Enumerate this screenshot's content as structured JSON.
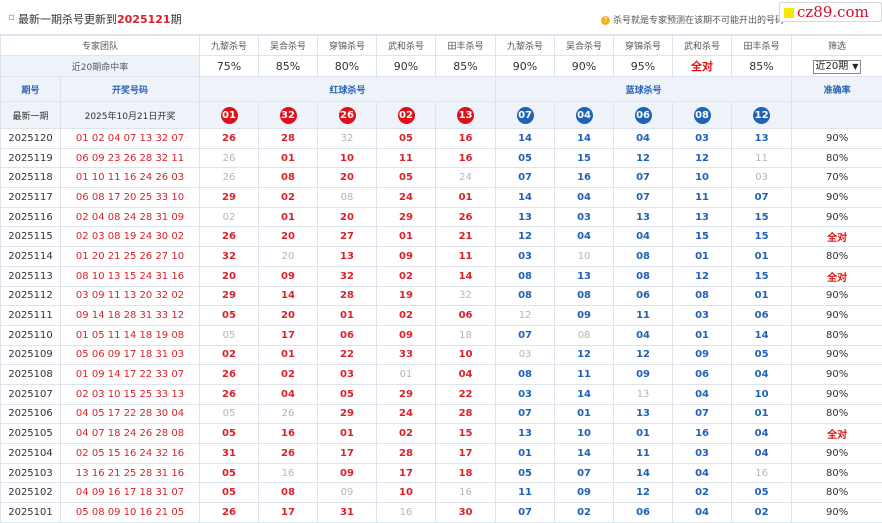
{
  "header": {
    "title_prefix": "最新一期杀号更新到",
    "title_issue": "2025121",
    "title_suffix": "期",
    "hint": "杀号就是专家预测在该期不可能开出的号码"
  },
  "logo": {
    "text": "cz89.com"
  },
  "experts": {
    "label": "专家团队",
    "names": [
      "九黎杀号",
      "吴合杀号",
      "穿锦杀号",
      "武和杀号",
      "田丰杀号",
      "九黎杀号",
      "吴合杀号",
      "穿锦杀号",
      "武和杀号",
      "田丰杀号"
    ],
    "filter_label": "筛选",
    "rate_label": "近20期命中率",
    "rates": [
      "75%",
      "85%",
      "80%",
      "90%",
      "85%",
      "90%",
      "90%",
      "95%",
      "全对",
      "85%"
    ],
    "select_value": "近20期"
  },
  "table": {
    "col_issue": "期号",
    "col_draw": "开奖号码",
    "col_red": "红球杀号",
    "col_blue": "蓝球杀号",
    "col_acc": "准确率",
    "latest_label": "最新一期",
    "latest_date": "2025年10月21日开奖",
    "latest_red": [
      "01",
      "32",
      "26",
      "02",
      "13"
    ],
    "latest_blue": [
      "07",
      "04",
      "06",
      "08",
      "12"
    ]
  },
  "rows": [
    {
      "issue": "2025120",
      "draw": "01 02 04 07 13 32 07",
      "red": [
        [
          "26",
          1
        ],
        [
          "28",
          1
        ],
        [
          "32",
          0
        ],
        [
          "05",
          1
        ],
        [
          "16",
          1
        ]
      ],
      "blue": [
        [
          "14",
          1
        ],
        [
          "14",
          1
        ],
        [
          "04",
          1
        ],
        [
          "03",
          1
        ],
        [
          "13",
          1
        ]
      ],
      "acc": "90%"
    },
    {
      "issue": "2025119",
      "draw": "06 09 23 26 28 32 11",
      "red": [
        [
          "26",
          0
        ],
        [
          "01",
          1
        ],
        [
          "10",
          1
        ],
        [
          "11",
          1
        ],
        [
          "16",
          1
        ]
      ],
      "blue": [
        [
          "05",
          1
        ],
        [
          "15",
          1
        ],
        [
          "12",
          1
        ],
        [
          "12",
          1
        ],
        [
          "11",
          0
        ]
      ],
      "acc": "80%"
    },
    {
      "issue": "2025118",
      "draw": "01 10 11 16 24 26 03",
      "red": [
        [
          "26",
          0
        ],
        [
          "08",
          1
        ],
        [
          "20",
          1
        ],
        [
          "05",
          1
        ],
        [
          "24",
          0
        ]
      ],
      "blue": [
        [
          "07",
          1
        ],
        [
          "16",
          1
        ],
        [
          "07",
          1
        ],
        [
          "10",
          1
        ],
        [
          "03",
          0
        ]
      ],
      "acc": "70%"
    },
    {
      "issue": "2025117",
      "draw": "06 08 17 20 25 33 10",
      "red": [
        [
          "29",
          1
        ],
        [
          "02",
          1
        ],
        [
          "08",
          0
        ],
        [
          "24",
          1
        ],
        [
          "01",
          1
        ]
      ],
      "blue": [
        [
          "14",
          1
        ],
        [
          "04",
          1
        ],
        [
          "07",
          1
        ],
        [
          "11",
          1
        ],
        [
          "07",
          1
        ]
      ],
      "acc": "90%"
    },
    {
      "issue": "2025116",
      "draw": "02 04 08 24 28 31 09",
      "red": [
        [
          "02",
          0
        ],
        [
          "01",
          1
        ],
        [
          "20",
          1
        ],
        [
          "29",
          1
        ],
        [
          "26",
          1
        ]
      ],
      "blue": [
        [
          "13",
          1
        ],
        [
          "03",
          1
        ],
        [
          "13",
          1
        ],
        [
          "13",
          1
        ],
        [
          "15",
          1
        ]
      ],
      "acc": "90%"
    },
    {
      "issue": "2025115",
      "draw": "02 03 08 19 24 30 02",
      "red": [
        [
          "26",
          1
        ],
        [
          "20",
          1
        ],
        [
          "27",
          1
        ],
        [
          "01",
          1
        ],
        [
          "21",
          1
        ]
      ],
      "blue": [
        [
          "12",
          1
        ],
        [
          "04",
          1
        ],
        [
          "04",
          1
        ],
        [
          "15",
          1
        ],
        [
          "15",
          1
        ]
      ],
      "acc": "全对"
    },
    {
      "issue": "2025114",
      "draw": "01 20 21 25 26 27 10",
      "red": [
        [
          "32",
          1
        ],
        [
          "20",
          0
        ],
        [
          "13",
          1
        ],
        [
          "09",
          1
        ],
        [
          "11",
          1
        ]
      ],
      "blue": [
        [
          "03",
          1
        ],
        [
          "10",
          0
        ],
        [
          "08",
          1
        ],
        [
          "01",
          1
        ],
        [
          "01",
          1
        ]
      ],
      "acc": "80%"
    },
    {
      "issue": "2025113",
      "draw": "08 10 13 15 24 31 16",
      "red": [
        [
          "20",
          1
        ],
        [
          "09",
          1
        ],
        [
          "32",
          1
        ],
        [
          "02",
          1
        ],
        [
          "14",
          1
        ]
      ],
      "blue": [
        [
          "08",
          1
        ],
        [
          "13",
          1
        ],
        [
          "08",
          1
        ],
        [
          "12",
          1
        ],
        [
          "15",
          1
        ]
      ],
      "acc": "全对"
    },
    {
      "issue": "2025112",
      "draw": "03 09 11 13 20 32 02",
      "red": [
        [
          "29",
          1
        ],
        [
          "14",
          1
        ],
        [
          "28",
          1
        ],
        [
          "19",
          1
        ],
        [
          "32",
          0
        ]
      ],
      "blue": [
        [
          "08",
          1
        ],
        [
          "08",
          1
        ],
        [
          "06",
          1
        ],
        [
          "08",
          1
        ],
        [
          "01",
          1
        ]
      ],
      "acc": "90%"
    },
    {
      "issue": "2025111",
      "draw": "09 14 18 28 31 33 12",
      "red": [
        [
          "05",
          1
        ],
        [
          "20",
          1
        ],
        [
          "01",
          1
        ],
        [
          "02",
          1
        ],
        [
          "06",
          1
        ]
      ],
      "blue": [
        [
          "12",
          0
        ],
        [
          "09",
          1
        ],
        [
          "11",
          1
        ],
        [
          "03",
          1
        ],
        [
          "06",
          1
        ]
      ],
      "acc": "90%"
    },
    {
      "issue": "2025110",
      "draw": "01 05 11 14 18 19 08",
      "red": [
        [
          "05",
          0
        ],
        [
          "17",
          1
        ],
        [
          "06",
          1
        ],
        [
          "09",
          1
        ],
        [
          "18",
          0
        ]
      ],
      "blue": [
        [
          "07",
          1
        ],
        [
          "08",
          0
        ],
        [
          "04",
          1
        ],
        [
          "01",
          1
        ],
        [
          "14",
          1
        ]
      ],
      "acc": "80%"
    },
    {
      "issue": "2025109",
      "draw": "05 06 09 17 18 31 03",
      "red": [
        [
          "02",
          1
        ],
        [
          "01",
          1
        ],
        [
          "22",
          1
        ],
        [
          "33",
          1
        ],
        [
          "10",
          1
        ]
      ],
      "blue": [
        [
          "03",
          0
        ],
        [
          "12",
          1
        ],
        [
          "12",
          1
        ],
        [
          "09",
          1
        ],
        [
          "05",
          1
        ]
      ],
      "acc": "90%"
    },
    {
      "issue": "2025108",
      "draw": "01 09 14 17 22 33 07",
      "red": [
        [
          "26",
          1
        ],
        [
          "02",
          1
        ],
        [
          "03",
          1
        ],
        [
          "01",
          0
        ],
        [
          "04",
          1
        ]
      ],
      "blue": [
        [
          "08",
          1
        ],
        [
          "11",
          1
        ],
        [
          "09",
          1
        ],
        [
          "06",
          1
        ],
        [
          "04",
          1
        ]
      ],
      "acc": "90%"
    },
    {
      "issue": "2025107",
      "draw": "02 03 10 15 25 33 13",
      "red": [
        [
          "26",
          1
        ],
        [
          "04",
          1
        ],
        [
          "05",
          1
        ],
        [
          "29",
          1
        ],
        [
          "22",
          1
        ]
      ],
      "blue": [
        [
          "03",
          1
        ],
        [
          "14",
          1
        ],
        [
          "13",
          0
        ],
        [
          "04",
          1
        ],
        [
          "10",
          1
        ]
      ],
      "acc": "90%"
    },
    {
      "issue": "2025106",
      "draw": "04 05 17 22 28 30 04",
      "red": [
        [
          "05",
          0
        ],
        [
          "26",
          0
        ],
        [
          "29",
          1
        ],
        [
          "24",
          1
        ],
        [
          "28",
          1
        ]
      ],
      "blue": [
        [
          "07",
          1
        ],
        [
          "01",
          1
        ],
        [
          "13",
          1
        ],
        [
          "07",
          1
        ],
        [
          "01",
          1
        ]
      ],
      "acc": "80%"
    },
    {
      "issue": "2025105",
      "draw": "04 07 18 24 26 28 08",
      "red": [
        [
          "05",
          1
        ],
        [
          "16",
          1
        ],
        [
          "01",
          1
        ],
        [
          "02",
          1
        ],
        [
          "15",
          1
        ]
      ],
      "blue": [
        [
          "13",
          1
        ],
        [
          "10",
          1
        ],
        [
          "01",
          1
        ],
        [
          "16",
          1
        ],
        [
          "04",
          1
        ]
      ],
      "acc": "全对"
    },
    {
      "issue": "2025104",
      "draw": "02 05 15 16 24 32 16",
      "red": [
        [
          "31",
          1
        ],
        [
          "26",
          1
        ],
        [
          "17",
          1
        ],
        [
          "28",
          1
        ],
        [
          "17",
          1
        ]
      ],
      "blue": [
        [
          "01",
          1
        ],
        [
          "14",
          1
        ],
        [
          "11",
          1
        ],
        [
          "03",
          1
        ],
        [
          "04",
          1
        ]
      ],
      "acc": "90%"
    },
    {
      "issue": "2025103",
      "draw": "13 16 21 25 28 31 16",
      "red": [
        [
          "05",
          1
        ],
        [
          "16",
          0
        ],
        [
          "09",
          1
        ],
        [
          "17",
          1
        ],
        [
          "18",
          1
        ]
      ],
      "blue": [
        [
          "05",
          1
        ],
        [
          "07",
          1
        ],
        [
          "14",
          1
        ],
        [
          "04",
          1
        ],
        [
          "16",
          0
        ]
      ],
      "acc": "80%"
    },
    {
      "issue": "2025102",
      "draw": "04 09 16 17 18 31 07",
      "red": [
        [
          "05",
          1
        ],
        [
          "08",
          1
        ],
        [
          "09",
          0
        ],
        [
          "10",
          1
        ],
        [
          "16",
          0
        ]
      ],
      "blue": [
        [
          "11",
          1
        ],
        [
          "09",
          1
        ],
        [
          "12",
          1
        ],
        [
          "02",
          1
        ],
        [
          "05",
          1
        ]
      ],
      "acc": "80%"
    },
    {
      "issue": "2025101",
      "draw": "05 08 09 10 16 21 05",
      "red": [
        [
          "26",
          1
        ],
        [
          "17",
          1
        ],
        [
          "31",
          1
        ],
        [
          "16",
          0
        ],
        [
          "30",
          1
        ]
      ],
      "blue": [
        [
          "07",
          1
        ],
        [
          "02",
          1
        ],
        [
          "06",
          1
        ],
        [
          "04",
          1
        ],
        [
          "02",
          1
        ]
      ],
      "acc": "90%"
    }
  ]
}
